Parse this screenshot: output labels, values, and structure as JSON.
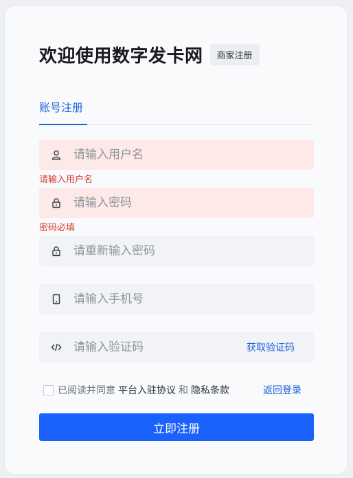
{
  "header": {
    "title": "欢迎使用数字发卡网",
    "merchant_badge": "商家注册"
  },
  "tabs": [
    {
      "label": "账号注册",
      "active": true
    }
  ],
  "form": {
    "username": {
      "placeholder": "请输入用户名",
      "value": "",
      "error": "请输入用户名",
      "icon": "user-icon"
    },
    "password": {
      "placeholder": "请输入密码",
      "value": "",
      "error": "密码必填",
      "icon": "lock-icon"
    },
    "confirm_password": {
      "placeholder": "请重新输入密码",
      "value": "",
      "icon": "lock-icon"
    },
    "phone": {
      "placeholder": "请输入手机号",
      "value": "",
      "icon": "mobile-icon"
    },
    "code": {
      "placeholder": "请输入验证码",
      "value": "",
      "icon": "code-icon",
      "get_code_label": "获取验证码"
    }
  },
  "agreement": {
    "checked": false,
    "prefix": "已阅读并同意",
    "platform_agreement": "平台入驻协议",
    "conjunction": "和",
    "privacy_terms": "隐私条款"
  },
  "links": {
    "back_to_login": "返回登录"
  },
  "submit_label": "立即注册",
  "colors": {
    "accent": "#1a62fb",
    "link": "#1b5fd9",
    "error_text": "#d93a2f",
    "error_bg": "#fde9e7",
    "field_bg": "#f1f3f6"
  }
}
